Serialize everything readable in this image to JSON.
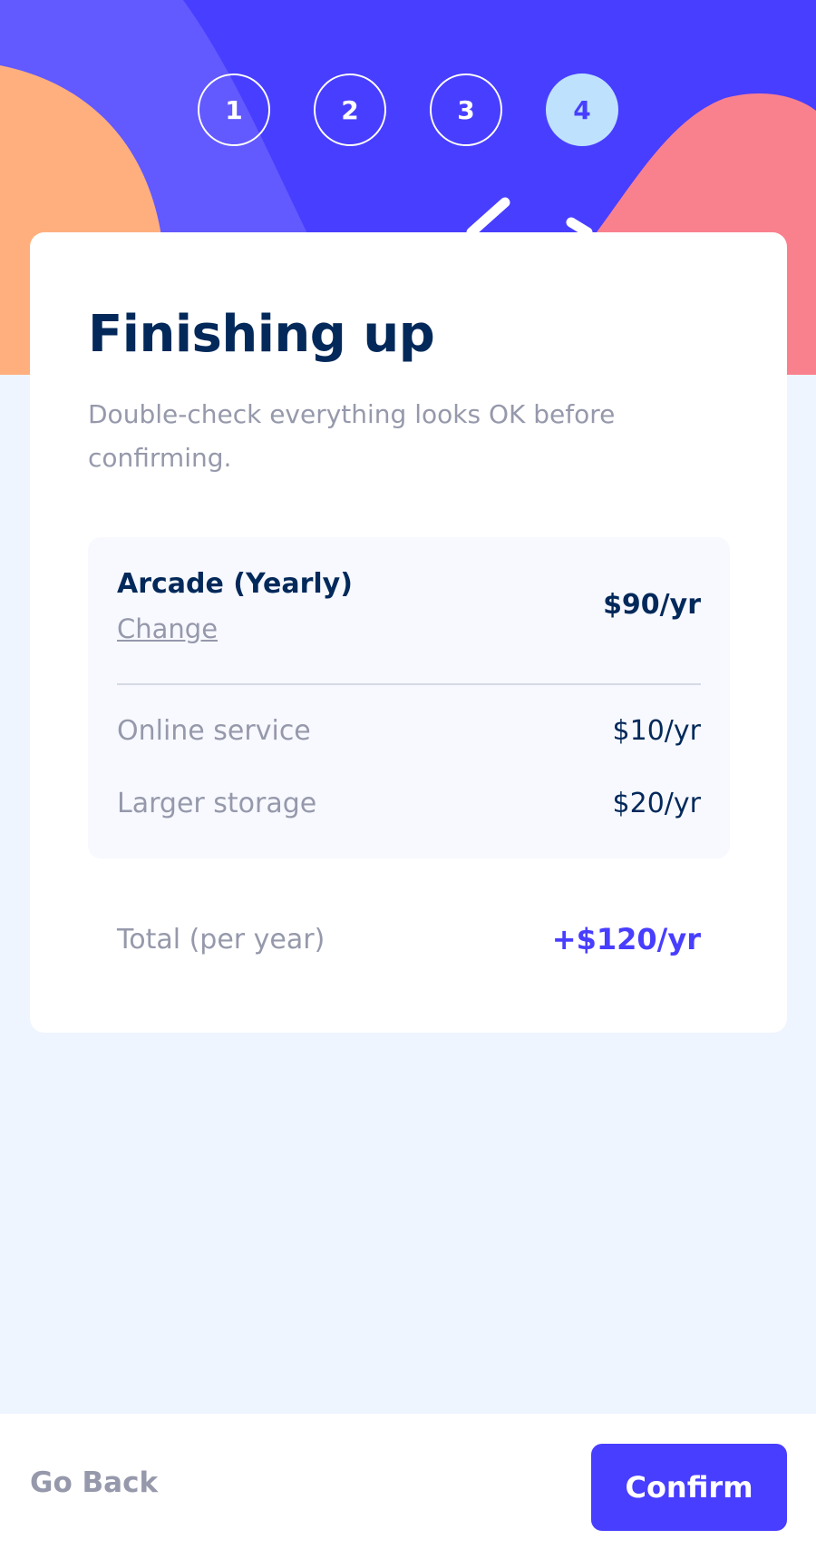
{
  "colors": {
    "header_blue": "#483eff",
    "header_light_blue": "#6259ff",
    "orange_blob": "#ffaf7e",
    "pink_blob": "#f9818e",
    "active_step_bg": "#bee2fd",
    "marine_blue": "#02295a",
    "cool_gray": "#9699ab",
    "page_bg": "#eff5ff"
  },
  "steps": [
    {
      "number": "1",
      "active": false
    },
    {
      "number": "2",
      "active": false
    },
    {
      "number": "3",
      "active": false
    },
    {
      "number": "4",
      "active": true
    }
  ],
  "page": {
    "title": "Finishing up",
    "subtitle": "Double-check everything looks OK before confirming."
  },
  "summary": {
    "plan_name": "Arcade (Yearly)",
    "change_label": "Change",
    "plan_price": "$90/yr",
    "addons": [
      {
        "label": "Online service",
        "price": "$10/yr"
      },
      {
        "label": "Larger storage",
        "price": "$20/yr"
      }
    ]
  },
  "total": {
    "label": "Total (per year)",
    "price": "+$120/yr"
  },
  "footer": {
    "back_label": "Go Back",
    "confirm_label": "Confirm"
  }
}
